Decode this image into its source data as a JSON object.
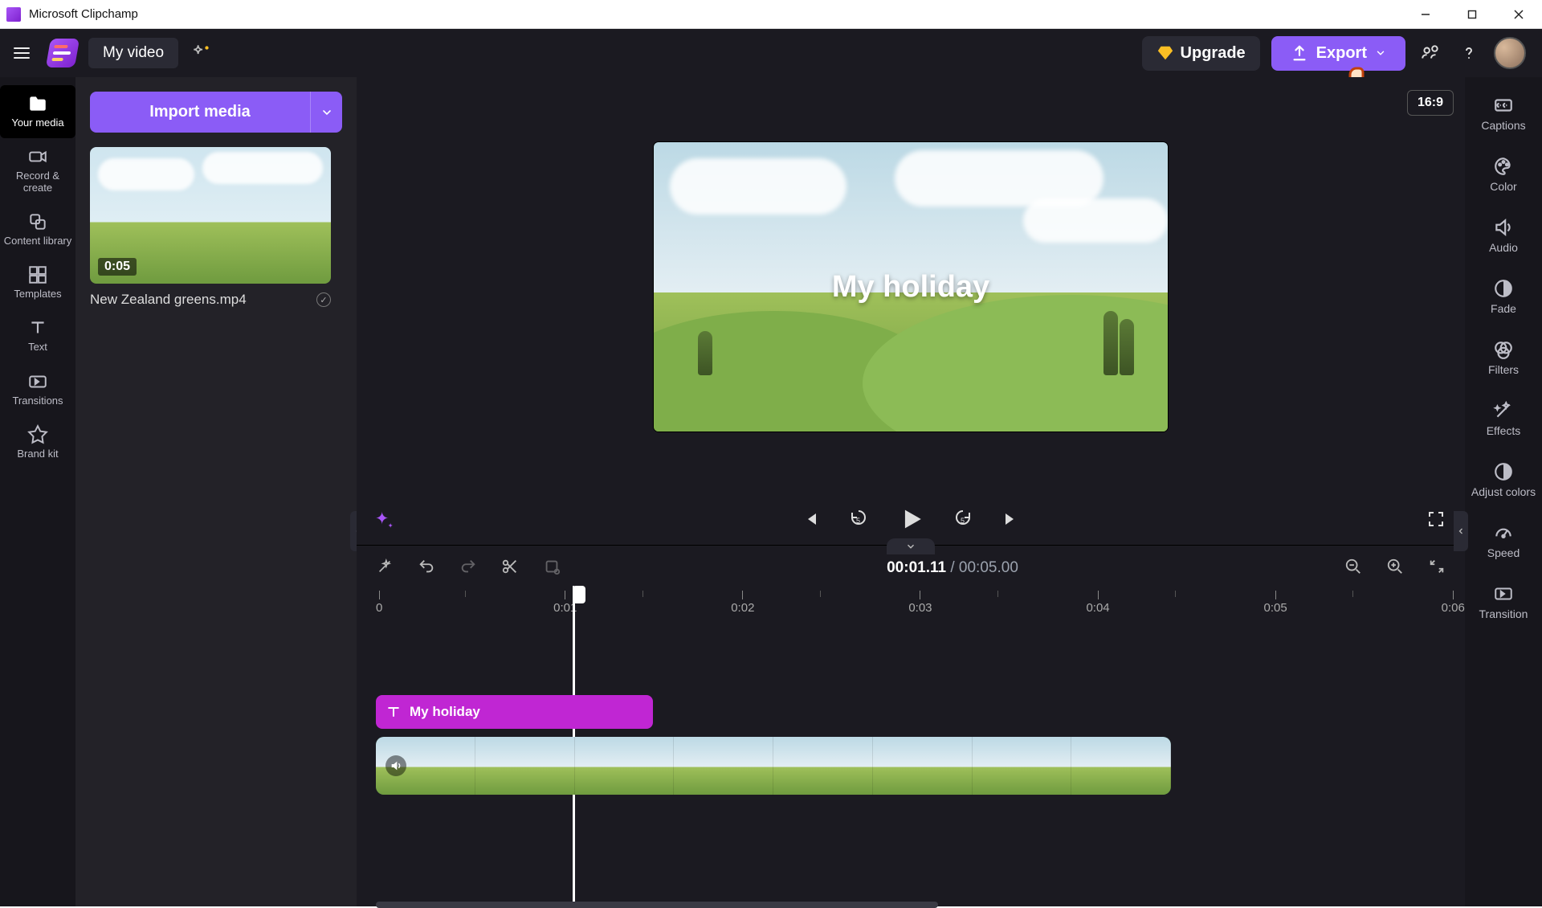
{
  "window": {
    "title": "Microsoft Clipchamp"
  },
  "appbar": {
    "project_name": "My video",
    "upgrade_label": "Upgrade",
    "export_label": "Export"
  },
  "nav": {
    "items": [
      {
        "id": "your-media",
        "label": "Your media"
      },
      {
        "id": "record",
        "label": "Record & create"
      },
      {
        "id": "library",
        "label": "Content library"
      },
      {
        "id": "templates",
        "label": "Templates"
      },
      {
        "id": "text",
        "label": "Text"
      },
      {
        "id": "transitions",
        "label": "Transitions"
      },
      {
        "id": "brandkit",
        "label": "Brand kit"
      }
    ]
  },
  "media_panel": {
    "import_label": "Import media",
    "items": [
      {
        "name": "New Zealand greens.mp4",
        "duration": "0:05"
      }
    ]
  },
  "stage": {
    "aspect_label": "16:9",
    "overlay_text": "My holiday"
  },
  "timeline": {
    "current": "00:01.11",
    "duration": "00:05.00",
    "ruler": [
      "0",
      "0:01",
      "0:02",
      "0:03",
      "0:04",
      "0:05",
      "0:06"
    ],
    "text_clip_label": "My holiday"
  },
  "rail": {
    "items": [
      {
        "id": "captions",
        "label": "Captions"
      },
      {
        "id": "color",
        "label": "Color"
      },
      {
        "id": "audio",
        "label": "Audio"
      },
      {
        "id": "fade",
        "label": "Fade"
      },
      {
        "id": "filters",
        "label": "Filters"
      },
      {
        "id": "effects",
        "label": "Effects"
      },
      {
        "id": "adjust",
        "label": "Adjust colors"
      },
      {
        "id": "speed",
        "label": "Speed"
      },
      {
        "id": "transition",
        "label": "Transition"
      }
    ]
  }
}
